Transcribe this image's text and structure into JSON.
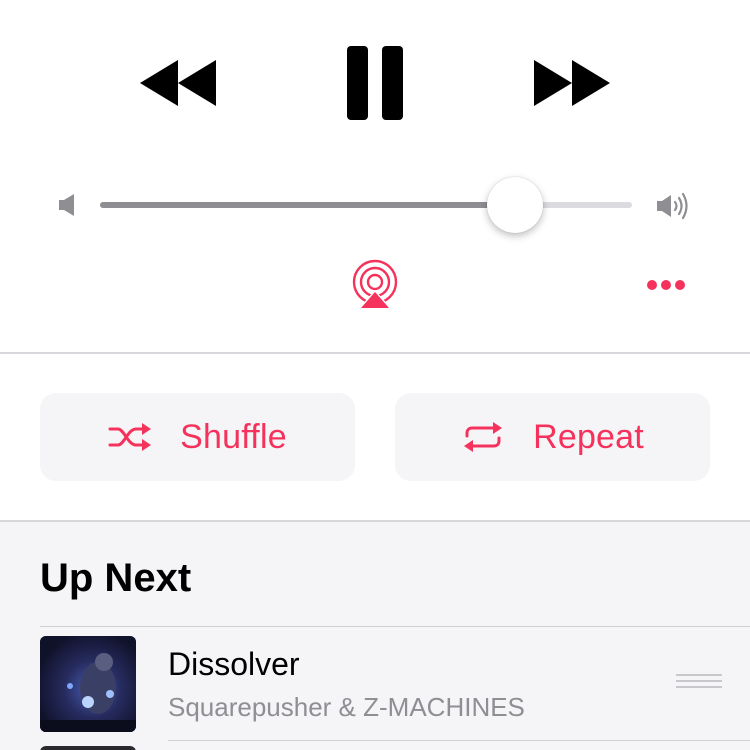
{
  "player": {
    "controls": {
      "rewind_icon": "rewind-icon",
      "pause_icon": "pause-icon",
      "forward_icon": "fast-forward-icon"
    },
    "volume": {
      "level": 0.78,
      "low_icon": "speaker-low-icon",
      "high_icon": "speaker-high-icon"
    },
    "airplay_icon": "airplay-icon",
    "more_icon": "ellipsis-icon"
  },
  "actions": {
    "shuffle_label": "Shuffle",
    "repeat_label": "Repeat",
    "shuffle_icon": "shuffle-icon",
    "repeat_icon": "repeat-icon"
  },
  "up_next": {
    "title": "Up Next",
    "tracks": [
      {
        "title": "Dissolver",
        "artist": "Squarepusher & Z-MACHINES"
      }
    ]
  },
  "colors": {
    "accent": "#f5325c",
    "secondary_text": "#8e8e93",
    "button_bg": "#f5f5f8"
  }
}
